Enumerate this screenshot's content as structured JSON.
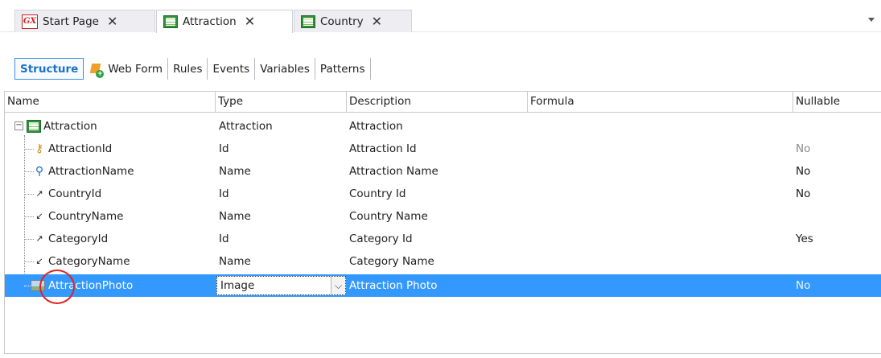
{
  "tabs": [
    {
      "label": "Start Page",
      "icon": "gx-logo-icon"
    },
    {
      "label": "Attraction",
      "icon": "transaction-icon"
    },
    {
      "label": "Country",
      "icon": "transaction-icon"
    }
  ],
  "close_glyph": "✕",
  "subtabs": [
    "Structure",
    "Web Form",
    "Rules",
    "Events",
    "Variables",
    "Patterns"
  ],
  "columns": [
    "Name",
    "Type",
    "Description",
    "Formula",
    "Nullable"
  ],
  "root": {
    "name": "Attraction",
    "type": "Attraction",
    "description": "Attraction",
    "formula": "",
    "nullable": ""
  },
  "rows": [
    {
      "name": "AttractionId",
      "icon": "key-icon",
      "type": "Id",
      "description": "Attraction Id",
      "formula": "",
      "nullable": "No"
    },
    {
      "name": "AttractionName",
      "icon": "search-icon",
      "type": "Name",
      "description": "Attraction Name",
      "formula": "",
      "nullable": "No"
    },
    {
      "name": "CountryId",
      "icon": "arrow-up-icon",
      "type": "Id",
      "description": "Country Id",
      "formula": "",
      "nullable": "No"
    },
    {
      "name": "CountryName",
      "icon": "arrow-down-icon",
      "type": "Name",
      "description": "Country Name",
      "formula": "",
      "nullable": ""
    },
    {
      "name": "CategoryId",
      "icon": "arrow-up-icon",
      "type": "Id",
      "description": "Category Id",
      "formula": "",
      "nullable": "Yes"
    },
    {
      "name": "CategoryName",
      "icon": "arrow-down-icon",
      "type": "Name",
      "description": "Category Name",
      "formula": "",
      "nullable": ""
    },
    {
      "name": "AttractionPhoto",
      "icon": "image-icon",
      "type": "Image",
      "description": "Attraction Photo",
      "formula": "",
      "nullable": "No",
      "selected": true
    }
  ],
  "colors": {
    "selection": "#3399ff",
    "active_subtab": "#1a73c8",
    "annotation": "#e02424"
  }
}
